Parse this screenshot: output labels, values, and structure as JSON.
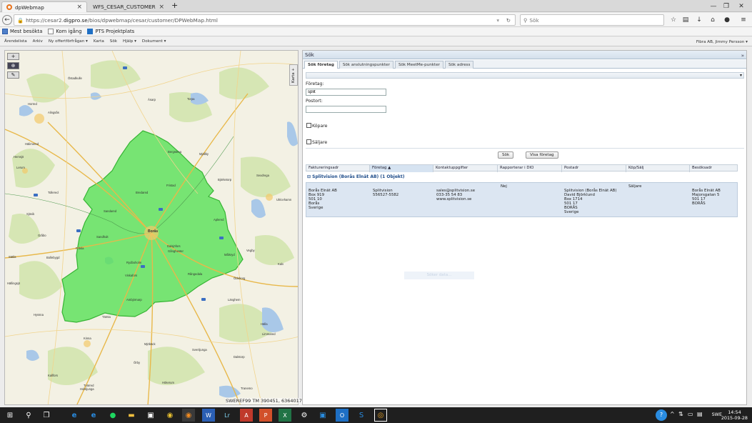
{
  "browser": {
    "tabs": [
      {
        "title": "dpWebmap"
      },
      {
        "title": "WFS_CESAR_CUSTOMER"
      }
    ],
    "url_prefix": "https://cesar2.",
    "url_domain": "digpro.se",
    "url_path": "/bios/dpwebmap/cesar/customer/DPWebMap.html",
    "search_placeholder": "Sök",
    "bookmarks": [
      "Mest besökta",
      "Kom igång",
      "PTS Projektplats"
    ],
    "window_controls": {
      "minimize": "—",
      "restore": "❐",
      "close": "✕"
    },
    "new_tab": "+"
  },
  "appmenu": {
    "items": [
      "Ärendelista",
      "Arkiv",
      "Ny offertförfrågan ▾",
      "Karta",
      "Sök",
      "Hjälp ▾",
      "Dokument ▾"
    ],
    "user": "Fibra AB, Jimmy Persson ▾"
  },
  "map": {
    "tab_label": "Karta +",
    "coordinates": "SWEREF99 TM 390451, 6364017",
    "tools": {
      "zoom_in": "+",
      "fit": "⊕",
      "ruler": "✎"
    },
    "polygon_color": "#5ce05a",
    "places": [
      "Östadkulle",
      "Alingsås",
      "Hälimered",
      "Hemsjö",
      "Lerum",
      "Tollered",
      "Sjövik",
      "Gråbo",
      "Bredared",
      "Sandhult",
      "Borås",
      "Dalsjöfors",
      "Fristad",
      "Bergstena",
      "Gånghester",
      "Målsryd",
      "Kinna",
      "Fritsla",
      "Viskafors",
      "Svenljunga",
      "Ulricehamn",
      "Aplered",
      "Sätila",
      "Hyssna",
      "Örby",
      "Rydboholm",
      "Mjöbäck",
      "Limmared",
      "Länghem",
      "Hällingsjö",
      "Bollebygd",
      "Sexdrega",
      "Kalv",
      "Dalstorp",
      "Tranemo",
      "Ambjörnarp",
      "Vegby",
      "Hälla",
      "Rångedala",
      "Tämta",
      "Björketorp",
      "Sandared",
      "Torpa",
      "Holsljunga",
      "Mjällby",
      "Kallfors",
      "Hökerum",
      "Ödeborg",
      "Horred",
      "Tvärred",
      "Äsarp"
    ]
  },
  "panel": {
    "title": "Sök",
    "collapse": "»",
    "tabs": [
      "Sök företag",
      "Sök anslutningspunkter",
      "Sök MeetMe-punkter",
      "Sök adress"
    ],
    "subbar_toggle": "▾",
    "form": {
      "company_label": "Företag:",
      "company_value": "split",
      "city_label": "Postort:",
      "city_value": "",
      "buyer_label": "Köpare",
      "seller_label": "Säljare",
      "search_button": "Sök",
      "show_button": "Visa företag"
    },
    "table": {
      "headers": [
        "Faktureringsadr",
        "Företag ▲",
        "Kontaktuppgifter",
        "Rapporterar i DIO",
        "Postadr",
        "Köp/Sälj",
        "Besöksadr"
      ],
      "group": "⊟ Splitvision (Borås Elnät AB) (1 Objekt)",
      "row": {
        "billing": [
          "Borås Elnät AB",
          "Box 919",
          "501 10",
          "Borås",
          "Sverige"
        ],
        "company": [
          "Splitvision",
          "556527-5582"
        ],
        "contact": [
          "sales@splitvision.se",
          "033-35 54 83",
          "www.splitvision.se"
        ],
        "dio": "Nej",
        "postal": [
          "Splitvision (Borås Elnät AB)",
          "David Björklund",
          "Box 1714",
          "501 17",
          "BORÅS",
          "Sverige"
        ],
        "buysell": "Säljare",
        "visit": [
          "Borås Elnät AB",
          "Majorsgatan 5",
          "501 17",
          "BORÅS"
        ]
      }
    },
    "ghost_text": "Söker data..."
  },
  "taskbar": {
    "lang": "SWE",
    "time": "14:54",
    "date": "2015-09-28",
    "start_icon": "⊞",
    "search_icon": "⚲",
    "taskview_icon": "❐"
  }
}
